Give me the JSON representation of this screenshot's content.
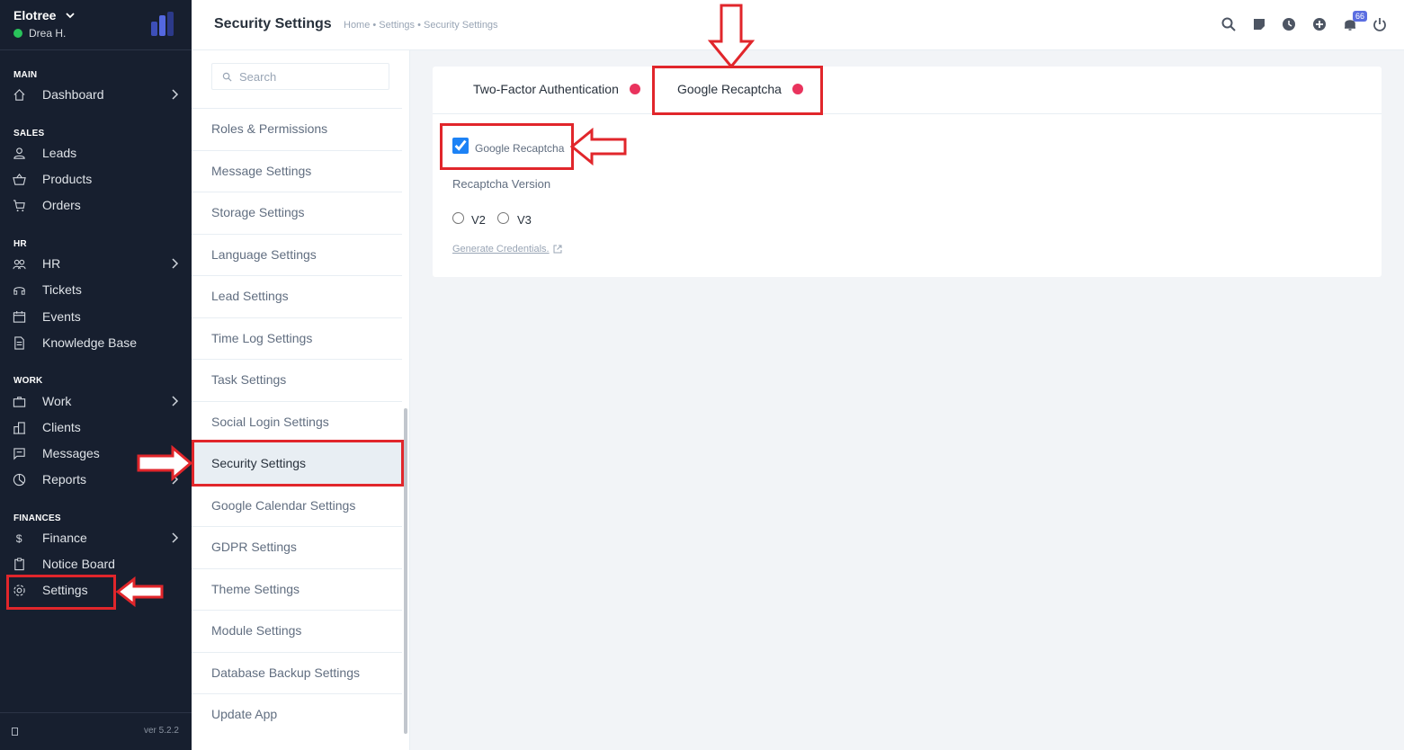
{
  "sidebar": {
    "company": "Elotree",
    "user": "Drea H.",
    "sections": {
      "main": "MAIN",
      "sales": "SALES",
      "hr": "HR",
      "work": "WORK",
      "finances": "FINANCES"
    },
    "items": {
      "dashboard": "Dashboard",
      "leads": "Leads",
      "products": "Products",
      "orders": "Orders",
      "hr": "HR",
      "tickets": "Tickets",
      "events": "Events",
      "knowledge_base": "Knowledge Base",
      "work": "Work",
      "clients": "Clients",
      "messages": "Messages",
      "reports": "Reports",
      "finance": "Finance",
      "notice_board": "Notice Board",
      "settings": "Settings"
    },
    "version": "ver 5.2.2"
  },
  "header": {
    "title": "Security Settings",
    "breadcrumb": "Home • Settings • Security Settings",
    "notification_count": "66"
  },
  "settings_menu": {
    "search_placeholder": "Search",
    "items": [
      "Roles & Permissions",
      "Message Settings",
      "Storage Settings",
      "Language Settings",
      "Lead Settings",
      "Time Log Settings",
      "Task Settings",
      "Social Login Settings",
      "Security Settings",
      "Google Calendar Settings",
      "GDPR Settings",
      "Theme Settings",
      "Module Settings",
      "Database Backup Settings",
      "Update App"
    ]
  },
  "content": {
    "tabs": [
      "Two-Factor Authentication",
      "Google Recaptcha"
    ],
    "checkbox_label": "Google Recaptcha",
    "version_label": "Recaptcha Version",
    "radio_v2": "V2",
    "radio_v3": "V3",
    "generate_link": "Generate Credentials."
  },
  "colors": {
    "sidebar_bg": "#171f2f",
    "accent": "#1d82f5",
    "tab_dot": "#e9335d",
    "annotation_red": "#e1262b",
    "online": "#29c35b"
  }
}
